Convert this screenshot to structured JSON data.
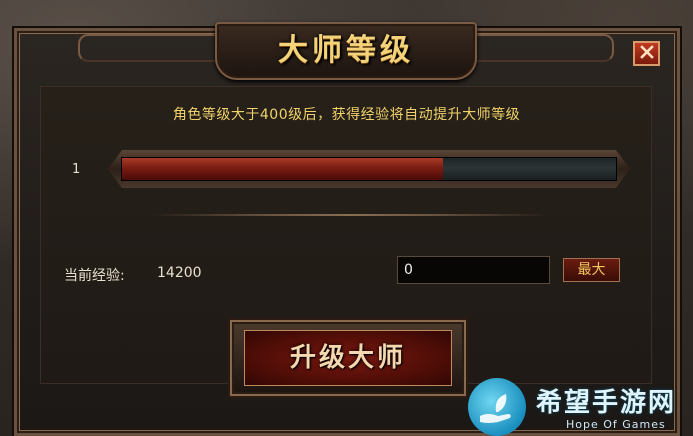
{
  "dialog": {
    "title": "大师等级",
    "close_icon": "close-icon",
    "notice": "角色等级大于400级后，获得经验将自动提升大师等级",
    "level": "1",
    "progress_fraction": 0.65,
    "exp_label": "当前经验:",
    "exp_value": "14200",
    "exp_input_value": "0",
    "max_label": "最大",
    "upgrade_label": "升级大师"
  },
  "colors": {
    "title_gold": "#f3d27a",
    "notice_gold": "#f2d36a",
    "progress_red": "#8a2418",
    "frame_bronze": "#6a5140"
  },
  "watermark": {
    "text": "希望手游网",
    "subtext": "Hope Of Games",
    "logo_icon": "hand-leaf-icon"
  }
}
